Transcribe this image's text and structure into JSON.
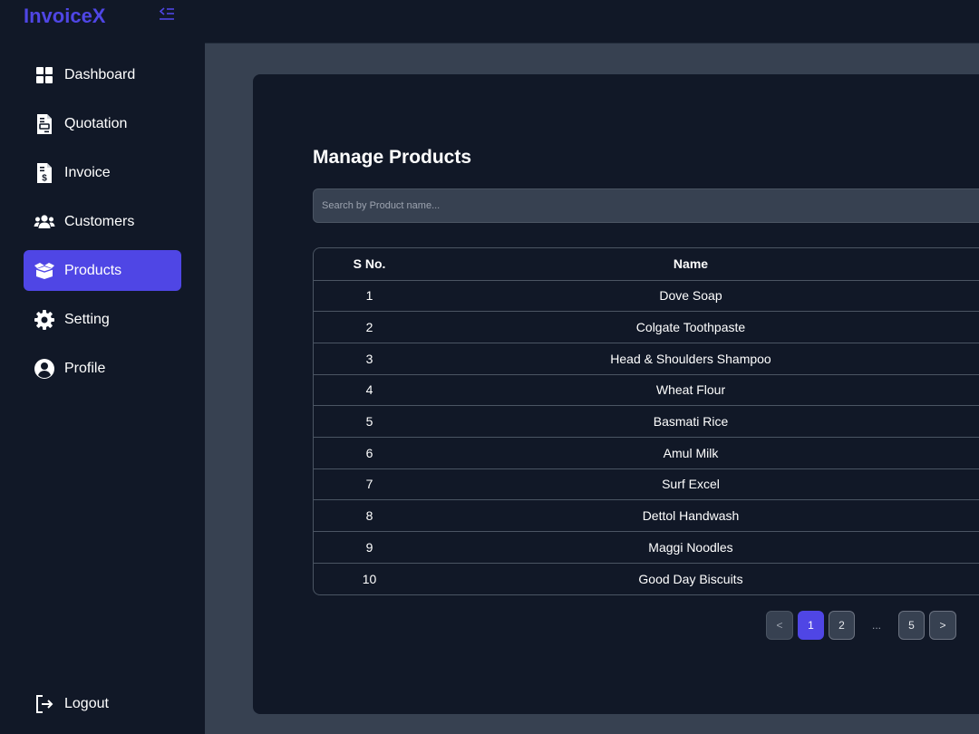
{
  "app": {
    "brand": "InvoiceX"
  },
  "sidebar": {
    "items": [
      {
        "label": "Dashboard",
        "icon": "dashboard-grid-icon"
      },
      {
        "label": "Quotation",
        "icon": "quotation-document-icon"
      },
      {
        "label": "Invoice",
        "icon": "invoice-dollar-icon"
      },
      {
        "label": "Customers",
        "icon": "users-icon"
      },
      {
        "label": "Products",
        "icon": "box-icon",
        "active": true
      },
      {
        "label": "Setting",
        "icon": "gear-icon"
      },
      {
        "label": "Profile",
        "icon": "user-circle-icon"
      }
    ],
    "logout_label": "Logout"
  },
  "main": {
    "title": "Manage Products",
    "search": {
      "placeholder": "Search by Product name...",
      "value": ""
    },
    "table": {
      "headers": [
        "S No.",
        "Name"
      ],
      "rows": [
        {
          "sno": "1",
          "name": "Dove Soap"
        },
        {
          "sno": "2",
          "name": "Colgate Toothpaste"
        },
        {
          "sno": "3",
          "name": "Head & Shoulders Shampoo"
        },
        {
          "sno": "4",
          "name": "Wheat Flour"
        },
        {
          "sno": "5",
          "name": "Basmati Rice"
        },
        {
          "sno": "6",
          "name": "Amul Milk"
        },
        {
          "sno": "7",
          "name": "Surf Excel"
        },
        {
          "sno": "8",
          "name": "Dettol Handwash"
        },
        {
          "sno": "9",
          "name": "Maggi Noodles"
        },
        {
          "sno": "10",
          "name": "Good Day Biscuits"
        }
      ]
    },
    "pagination": {
      "prev": "<",
      "pages": [
        "1",
        "2"
      ],
      "ellipsis": "...",
      "last": "5",
      "next": ">",
      "current": "1"
    }
  },
  "colors": {
    "accent": "#4f46e5",
    "sidebar_bg": "#111827",
    "page_bg": "#374151",
    "card_bg": "#111827"
  }
}
